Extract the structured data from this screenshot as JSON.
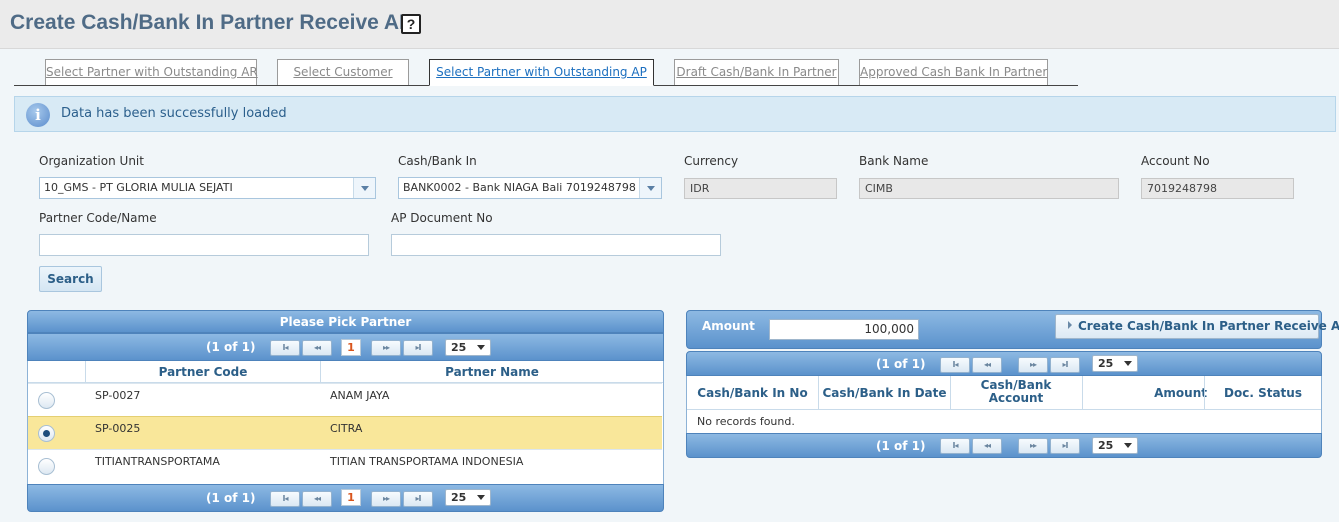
{
  "page": {
    "title": "Create Cash/Bank In Partner Receive AP",
    "help_icon": "?"
  },
  "tabs": [
    {
      "label": "Select Partner with Outstanding AR",
      "active": false
    },
    {
      "label": "Select Customer",
      "active": false
    },
    {
      "label": "Select Partner with Outstanding AP",
      "active": true
    },
    {
      "label": "Draft Cash/Bank In Partner",
      "active": false
    },
    {
      "label": "Approved Cash Bank In Partner",
      "active": false
    }
  ],
  "info": {
    "icon": "i",
    "message": "Data has been successfully loaded"
  },
  "form": {
    "org_unit_label": "Organization Unit",
    "org_unit_value": "10_GMS - PT GLORIA MULIA SEJATI",
    "cashbank_label": "Cash/Bank In",
    "cashbank_value": "BANK0002 - Bank NIAGA Bali 7019248798",
    "currency_label": "Currency",
    "currency_value": "IDR",
    "bank_name_label": "Bank Name",
    "bank_name_value": "CIMB",
    "account_no_label": "Account No",
    "account_no_value": "7019248798",
    "partner_label": "Partner Code/Name",
    "partner_value": "",
    "ap_doc_label": "AP Document No",
    "ap_doc_value": "",
    "search_label": "Search"
  },
  "partner_table": {
    "title": "Please Pick Partner",
    "pager_text": "(1 of 1)",
    "page_number": "1",
    "rows_per_page": "25",
    "pager_buttons": {
      "first": "I◂",
      "prev": "◂◂",
      "next": "▸▸",
      "last": "▸I"
    },
    "columns": [
      "Partner Code",
      "Partner Name"
    ],
    "rows": [
      {
        "code": "SP-0027",
        "name": "ANAM JAYA",
        "selected": false
      },
      {
        "code": "SP-0025",
        "name": "CITRA",
        "selected": true
      },
      {
        "code": "TITIANTRANSPORTAMA",
        "name": "TITIAN TRANSPORTAMA INDONESIA",
        "selected": false
      }
    ]
  },
  "right_panel": {
    "amount_label": "Amount",
    "amount_value": "100,000",
    "create_button": "Create Cash/Bank In Partner Receive AP",
    "pager_text": "(1 of 1)",
    "rows_per_page": "25",
    "columns": [
      "Cash/Bank In No",
      "Cash/Bank In Date",
      "Cash/Bank Account",
      "Amount",
      "Doc. Status"
    ],
    "empty_message": "No records found."
  }
}
